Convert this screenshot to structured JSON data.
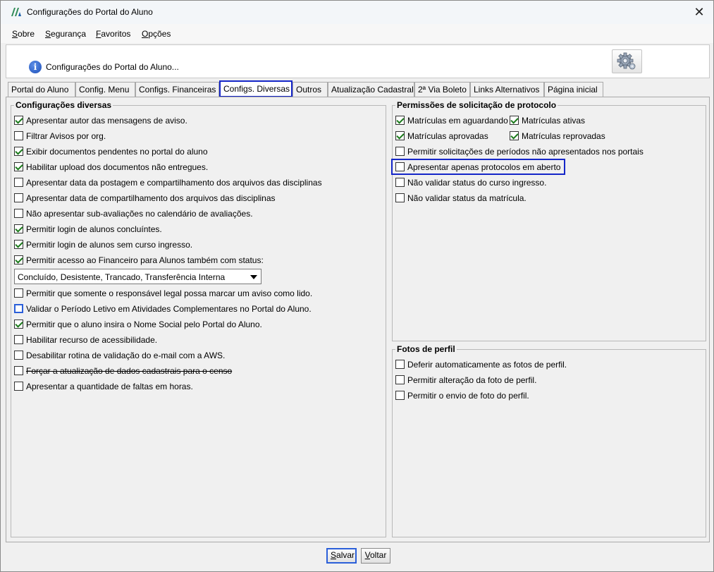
{
  "window": {
    "title": "Configurações do Portal do Aluno",
    "close_glyph": "✕"
  },
  "menu": {
    "items": [
      {
        "label": "Sobre",
        "mnemonic": "S",
        "rest": "obre"
      },
      {
        "label": "Segurança",
        "mnemonic": "S",
        "rest": "egurança"
      },
      {
        "label": "Favoritos",
        "mnemonic": "F",
        "rest": "avoritos"
      },
      {
        "label": "Opções",
        "mnemonic": "O",
        "rest": "pções"
      }
    ]
  },
  "header": {
    "text": "Configurações do Portal do Aluno...",
    "icon": "info-icon",
    "settings_icon": "gear-icon"
  },
  "tabs": [
    {
      "label": "Portal do Aluno",
      "active": false
    },
    {
      "label": "Config. Menu",
      "active": false
    },
    {
      "label": "Configs. Financeiras",
      "active": false
    },
    {
      "label": "Configs. Diversas",
      "active": true
    },
    {
      "label": "Outros",
      "active": false
    },
    {
      "label": "Atualização Cadastral",
      "active": false
    },
    {
      "label": "2ª Via Boleto",
      "active": false
    },
    {
      "label": "Links Alternativos",
      "active": false
    },
    {
      "label": "Página inicial",
      "active": false
    }
  ],
  "diversas": {
    "title": "Configurações diversas",
    "items": [
      {
        "label": "Apresentar autor das mensagens de aviso.",
        "checked": true
      },
      {
        "label": "Filtrar Avisos por org.",
        "checked": false
      },
      {
        "label": "Exibir documentos pendentes no portal do aluno",
        "checked": true
      },
      {
        "label": "Habilitar upload dos documentos não entregues.",
        "checked": true
      },
      {
        "label": "Apresentar data da postagem e compartilhamento dos arquivos das disciplinas",
        "checked": false
      },
      {
        "label": "Apresentar data de compartilhamento dos arquivos das disciplinas",
        "checked": false
      },
      {
        "label": "Não apresentar sub-avaliações no calendário de avaliações.",
        "checked": false
      },
      {
        "label": "Permitir login de alunos concluíntes.",
        "checked": true
      },
      {
        "label": "Permitir login de alunos sem curso ingresso.",
        "checked": true
      },
      {
        "label": "Permitir acesso ao Financeiro para Alunos também com status:",
        "checked": true
      }
    ],
    "status_select": "Concluído, Desistente, Trancado, Transferência Interna",
    "items2": [
      {
        "label": "Permitir que somente o responsável legal possa marcar um aviso como lido.",
        "checked": false
      },
      {
        "label": "Validar o Período Letivo em Atividades Complementares no Portal do Aluno.",
        "checked": false
      },
      {
        "label": "Permitir que o aluno insira o Nome Social pelo Portal do Aluno.",
        "checked": true
      },
      {
        "label": "Habilitar recurso de acessibilidade.",
        "checked": false
      },
      {
        "label": "Desabilitar rotina de validação do e-mail com a AWS.",
        "checked": false
      },
      {
        "label": "Forçar a atualização de dados cadastrais para o censo",
        "checked": false
      },
      {
        "label": "Apresentar a quantidade de faltas em horas.",
        "checked": false
      }
    ]
  },
  "protocolo": {
    "title": "Permissões de solicitação de protocolo",
    "items": [
      {
        "label": "Matrículas em aguardando",
        "checked": true
      },
      {
        "label": "Matrículas ativas",
        "checked": true
      },
      {
        "label": "Matrículas aprovadas",
        "checked": true
      },
      {
        "label": "Matrículas reprovadas",
        "checked": true
      },
      {
        "label": "Permitir solicitações de períodos não apresentados nos portais",
        "checked": false
      },
      {
        "label": "Apresentar apenas protocolos em aberto",
        "checked": false
      },
      {
        "label": "Não validar status do curso ingresso.",
        "checked": false
      },
      {
        "label": "Não validar status da matrícula.",
        "checked": false
      }
    ]
  },
  "fotos": {
    "title": "Fotos de perfil",
    "items": [
      {
        "label": "Deferir automaticamente as fotos de perfil.",
        "checked": false
      },
      {
        "label": "Permitir alteração da foto de perfil.",
        "checked": false
      },
      {
        "label": "Permitir o envio de foto do perfil.",
        "checked": false
      }
    ]
  },
  "buttons": {
    "save": {
      "mnemonic": "S",
      "rest": "alvar"
    },
    "back": {
      "mnemonic": "V",
      "rest": "oltar"
    }
  }
}
